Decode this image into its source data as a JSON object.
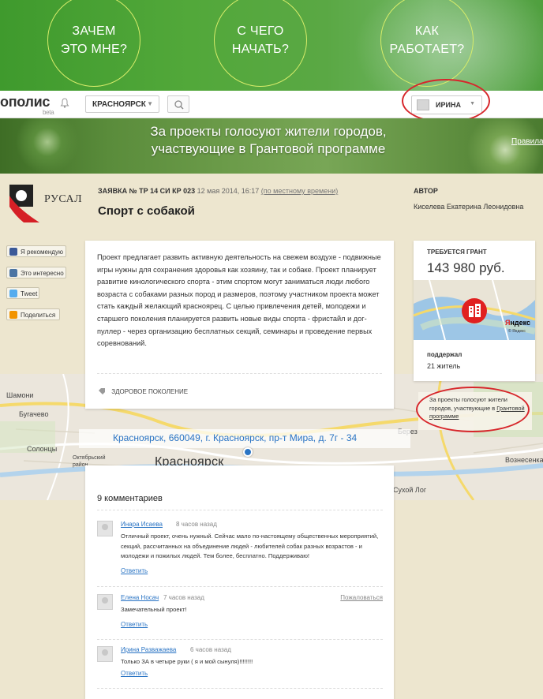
{
  "hero": {
    "items": [
      "ЗАЧЕМ\nЭТО МНЕ?",
      "С ЧЕГО\nНАЧАТЬ?",
      "КАК\nРАБОТАЕТ?"
    ]
  },
  "topbar": {
    "logo": "ополис",
    "beta": "beta",
    "city": "КРАСНОЯРСК",
    "user": "ИРИНА"
  },
  "banner": {
    "text": "За проекты голосуют жители городов,\nучаствующие в Грантовой программе",
    "link": "Правила"
  },
  "sponsor": {
    "name": "РУСАЛ"
  },
  "application": {
    "number": "ЗАЯВКА № ТР 14 СИ КР 023",
    "date": "12 мая 2014, 16:17",
    "timezone": "(по местному времени)",
    "title": "Спорт с собакой",
    "author_label": "АВТОР",
    "author": "Киселева Екатерина Леонидовна"
  },
  "social": {
    "recommend": "Я рекомендую",
    "interesting": "Это интересно",
    "tweet": "Tweet",
    "share": "Поделиться"
  },
  "description": {
    "text": "Проект предлагает развить активную деятельность на свежем воздухе - подвижные игры нужны для сохранения здоровья как хозяину, так и собаке. Проект планирует развитие кинологического спорта - этим спортом могут заниматься люди любого возраста с собаками разных пород и размеров, поэтому участником проекта может стать каждый желающий красноярец. С целью привлечения детей, молодежи и старшего поколения планируется развить новые виды спорта - фристайл и дог-пуллер - через организацию бесплатных секций, семинары и проведение первых соревнований.",
    "tag": "ЗДОРОВОЕ ПОКОЛЕНИЕ"
  },
  "grant": {
    "label": "ТРЕБУЕТСЯ ГРАНТ",
    "amount": "143 980 руб.",
    "map_brand_y": "Я",
    "map_brand_rest": "ндекс",
    "map_copy": "© Яндекс",
    "support_label": "поддержал",
    "support_count": "21 житель"
  },
  "grant_note": {
    "text": "За проекты голосуют жители городов, участвующие в",
    "link": "Грантовой программе"
  },
  "map": {
    "address": "Красноярск, 660049, г. Красноярск, пр-т Мира, д. 7г - 34",
    "city": "Красноярск",
    "labels": [
      "Шамони",
      "Бугачево",
      "Октябрьский район",
      "Солонцы",
      "Вознесенка",
      "Берез",
      "Сухой Лог"
    ]
  },
  "comments": {
    "title": "9 комментариев",
    "items": [
      {
        "author": "Инара Исаева",
        "time": "8 часов назад",
        "text": "Отличный проект, очень нужный. Сейчас мало по-настоящему общественных мероприятий, секций, рассчитанных на объединение людей - любителей собак разных возрастов - и молодежи и пожилых людей. Тем более, бесплатно. Поддерживаю!",
        "reply": "Ответить",
        "report": ""
      },
      {
        "author": "Елена Носач",
        "time": "7 часов назад",
        "text": "Замечательный проект!",
        "reply": "Ответить",
        "report": "Пожаловаться"
      },
      {
        "author": "Ирина Разважаева",
        "time": "6 часов назад",
        "text": "Только ЗА в четыре руки ( я и мой сынуля)!!!!!!!!",
        "reply": "Ответить",
        "report": ""
      }
    ]
  },
  "colors": {
    "hero_green": "#4c9f35",
    "circle_outline": "#d7ec6a",
    "link_blue": "#2a74c4",
    "annotation_red": "#d7262b",
    "page_bg": "#ede6cf"
  }
}
